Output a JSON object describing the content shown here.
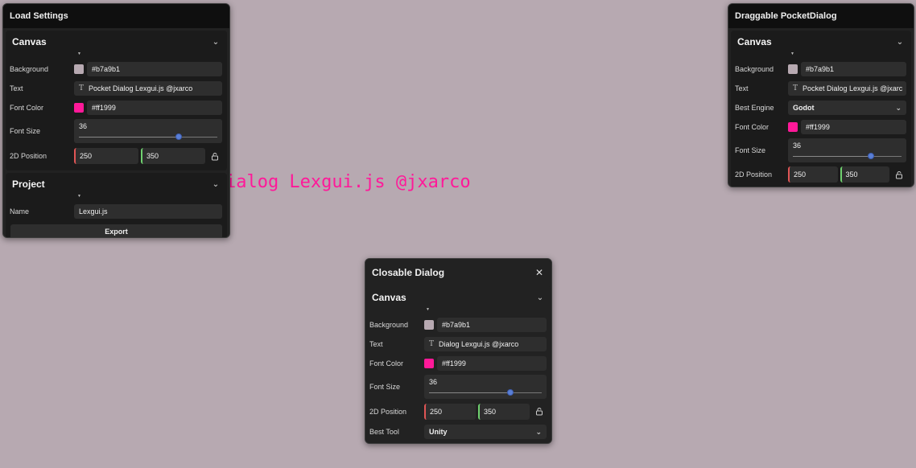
{
  "canvas_text": "Pocket Dialog Lexgui.js @jxarco",
  "load_settings": {
    "title": "Load Settings",
    "canvas_section": {
      "title": "Canvas",
      "background_label": "Background",
      "background_value": "#b7a9b1",
      "text_label": "Text",
      "text_value": "Pocket Dialog Lexgui.js @jxarco",
      "font_color_label": "Font Color",
      "font_color_value": "#ff1999",
      "font_size_label": "Font Size",
      "font_size_value": "36",
      "position_label": "2D Position",
      "pos_x": "250",
      "pos_y": "350"
    },
    "project_section": {
      "title": "Project",
      "name_label": "Name",
      "name_value": "Lexgui.js",
      "export_label": "Export"
    }
  },
  "pocket_dialog": {
    "title": "Draggable PocketDialog",
    "canvas_section": {
      "title": "Canvas",
      "background_label": "Background",
      "background_value": "#b7a9b1",
      "text_label": "Text",
      "text_value": "Pocket Dialog Lexgui.js @jxarc",
      "engine_label": "Best Engine",
      "engine_value": "Godot",
      "font_color_label": "Font Color",
      "font_color_value": "#ff1999",
      "font_size_label": "Font Size",
      "font_size_value": "36",
      "position_label": "2D Position",
      "pos_x": "250",
      "pos_y": "350"
    }
  },
  "closable_dialog": {
    "title": "Closable Dialog",
    "canvas_section": {
      "title": "Canvas",
      "background_label": "Background",
      "background_value": "#b7a9b1",
      "text_label": "Text",
      "text_value": "Dialog Lexgui.js @jxarco",
      "font_color_label": "Font Color",
      "font_color_value": "#ff1999",
      "font_size_label": "Font Size",
      "font_size_value": "36",
      "position_label": "2D Position",
      "pos_x": "250",
      "pos_y": "350",
      "tool_label": "Best Tool",
      "tool_value": "Unity"
    }
  },
  "font_size_slider_level": 0.72,
  "colors": {
    "background_swatch": "#b7a9b1",
    "font_color_swatch": "#ff1999",
    "x_axis": "#e05555",
    "y_axis": "#6fd16f",
    "slider_thumb": "#5a7fd6"
  },
  "icons": {
    "chevron": "chevron-down-icon",
    "lock": "lock-icon",
    "text_type": "text-type-icon",
    "close": "close-icon"
  }
}
